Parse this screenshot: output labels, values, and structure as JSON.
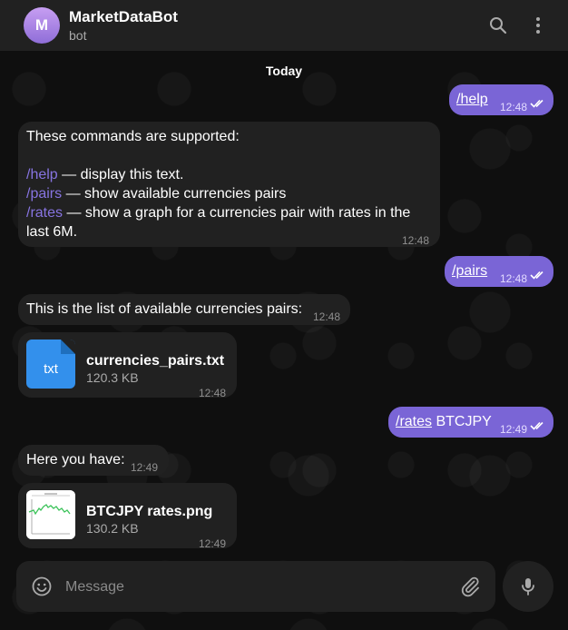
{
  "header": {
    "avatar_letter": "M",
    "title": "MarketDataBot",
    "subtitle": "bot",
    "icons": [
      "search-icon",
      "more-vertical-icon"
    ]
  },
  "chat": {
    "date_label": "Today",
    "messages": [
      {
        "dir": "out",
        "text": "/help",
        "time": "12:48"
      },
      {
        "dir": "in",
        "lines": [
          {
            "text": "These commands are supported:"
          },
          {
            "cmd": "/help",
            "text": " — display this text."
          },
          {
            "cmd": "/pairs",
            "text": " — show available currencies pairs"
          },
          {
            "cmd": "/rates",
            "text": " — show a graph for a currencies pair with rates in the"
          },
          {
            "text": "last 6M."
          }
        ],
        "time": "12:48"
      },
      {
        "dir": "out",
        "text": "/pairs",
        "time": "12:48"
      },
      {
        "dir": "in",
        "text": "This is the list of available currencies pairs:",
        "time": "12:48"
      },
      {
        "dir": "in",
        "file": {
          "icon_label": "txt",
          "name": "currencies_pairs.txt",
          "size": "120.3 KB"
        },
        "time": "12:48"
      },
      {
        "dir": "out",
        "cmd": "/rates",
        "text": " BTCJPY",
        "time": "12:49"
      },
      {
        "dir": "in",
        "text": "Here you have:",
        "time": "12:49"
      },
      {
        "dir": "in",
        "file": {
          "name": "BTCJPY rates.png",
          "size": "130.2 KB"
        },
        "time": "12:49"
      }
    ]
  },
  "composer": {
    "placeholder": "Message",
    "icons": [
      "emoji-icon",
      "attach-icon",
      "mic-icon"
    ]
  },
  "colors": {
    "background": "#0f0f0f",
    "panel": "#212121",
    "incoming": "#212121",
    "outgoing": "#7a65d6",
    "accent": "#8774e1",
    "file_icon": "#3390ec"
  }
}
